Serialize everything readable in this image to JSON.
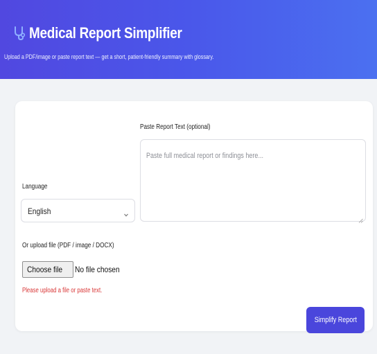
{
  "header": {
    "title": "Medical Report Simplifier",
    "subtitle": "Upload a PDF/image or paste report text — get a short, patient-friendly summary with glossary.",
    "icon": "stethoscope-icon",
    "gradient_colors": [
      "#5148e0",
      "#4b70f0"
    ]
  },
  "form": {
    "paste_label": "Paste Report Text (optional)",
    "paste_placeholder": "Paste full medical report or findings here...",
    "language_label": "Language",
    "language_value": "English",
    "upload_label": "Or upload file (PDF / image / DOCX)",
    "choose_file_label": "Choose file",
    "no_file_text": "No file chosen",
    "error_text": "Please upload a file or paste text.",
    "submit_label": "Simplify Report"
  },
  "colors": {
    "accent": "#4a46dc",
    "error": "#d93636"
  }
}
